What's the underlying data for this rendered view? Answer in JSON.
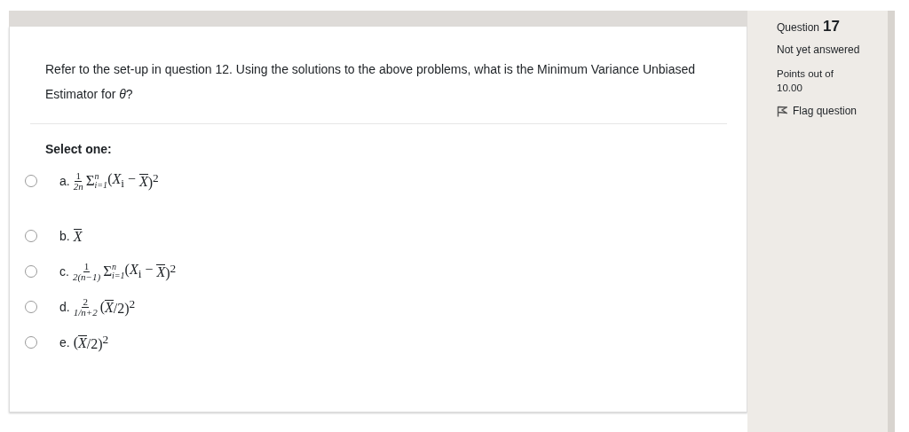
{
  "question_text": "Refer to the set-up in question 12. Using the solutions to the above problems, what is the Minimum Variance Unbiased Estimator for *θ*?",
  "prompt": "Select one:",
  "options": [
    {
      "letter": "a.",
      "selected": false,
      "parts": [
        {
          "kind": "frac",
          "num": "1",
          "den": "2n"
        },
        {
          "kind": "sum",
          "symbol": "Σ",
          "sub": "i=1",
          "sup": "n"
        },
        {
          "kind": "text",
          "text": "(*X*$_{i}$ − "
        },
        {
          "kind": "xbar",
          "text": "X"
        },
        {
          "kind": "text",
          "text": ")$^{2}$"
        }
      ]
    },
    {
      "letter": "b.",
      "selected": false,
      "parts": [
        {
          "kind": "xbar",
          "text": "X"
        }
      ]
    },
    {
      "letter": "c.",
      "selected": false,
      "parts": [
        {
          "kind": "frac",
          "num": "1",
          "den": "2(n−1)"
        },
        {
          "kind": "sum",
          "symbol": "Σ",
          "sub": "i=1",
          "sup": "n"
        },
        {
          "kind": "text",
          "text": "(*X*$_{i}$ − "
        },
        {
          "kind": "xbar",
          "text": "X"
        },
        {
          "kind": "text",
          "text": ")$^{2}$"
        }
      ]
    },
    {
      "letter": "d.",
      "selected": false,
      "parts": [
        {
          "kind": "frac",
          "num": "2",
          "den": "1/n+2"
        },
        {
          "kind": "text",
          "text": "("
        },
        {
          "kind": "xbar",
          "text": "X"
        },
        {
          "kind": "text",
          "text": "/2)$^{2}$"
        }
      ]
    },
    {
      "letter": "e.",
      "selected": false,
      "parts": [
        {
          "kind": "text",
          "text": "("
        },
        {
          "kind": "xbar",
          "text": "X"
        },
        {
          "kind": "text",
          "text": "/2)$^{2}$"
        }
      ]
    }
  ],
  "info": {
    "question_label": "Question",
    "question_number": "17",
    "status": "Not yet answered",
    "points_label": "Points out of",
    "points_value": "10.00",
    "flag_label": "Flag question"
  }
}
